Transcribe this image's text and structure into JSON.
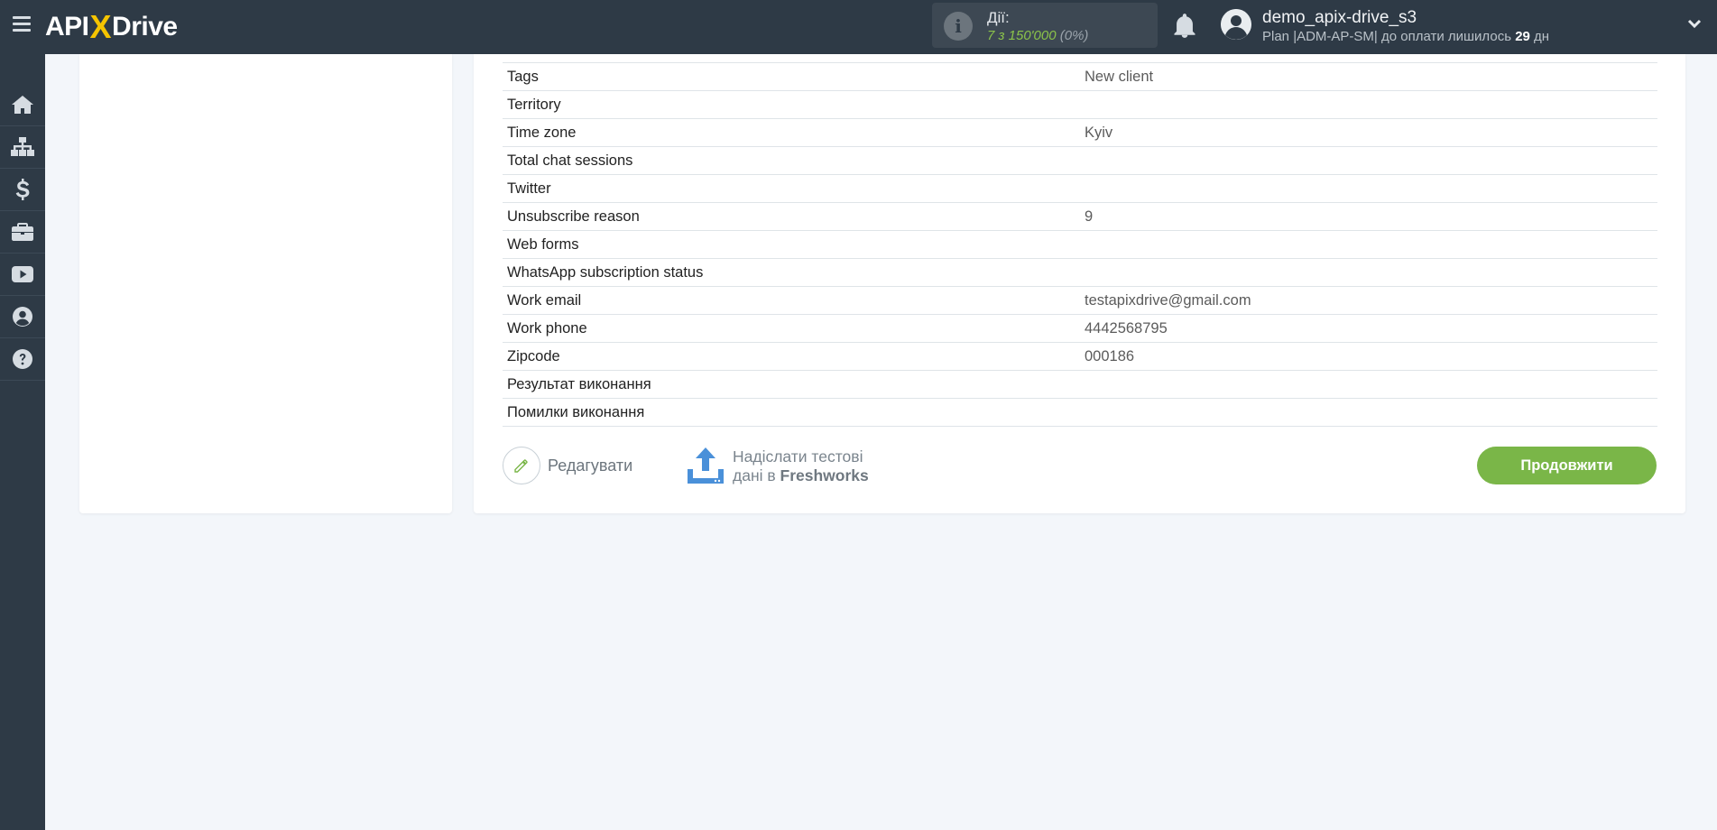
{
  "header": {
    "logo": {
      "left": "API",
      "x": "X",
      "right": "Drive"
    },
    "actions": {
      "label": "Дії:",
      "used": "7",
      "of": " з 150'000",
      "percent": " (0%)"
    },
    "user": {
      "name": "demo_apix-drive_s3",
      "plan_prefix": "Plan |ADM-AP-SM| до оплати лишилось ",
      "days": "29",
      "days_suffix": " дн"
    }
  },
  "sidebar": {
    "items": [
      "home-icon",
      "sitemap-icon",
      "dollar-icon",
      "briefcase-icon",
      "video-icon",
      "user-icon",
      "help-icon"
    ]
  },
  "table": {
    "rows": [
      {
        "field": "Tags",
        "value": "New client"
      },
      {
        "field": "Territory",
        "value": ""
      },
      {
        "field": "Time zone",
        "value": "Kyiv"
      },
      {
        "field": "Total chat sessions",
        "value": ""
      },
      {
        "field": "Twitter",
        "value": ""
      },
      {
        "field": "Unsubscribe reason",
        "value": "9"
      },
      {
        "field": "Web forms",
        "value": ""
      },
      {
        "field": "WhatsApp subscription status",
        "value": ""
      },
      {
        "field": "Work email",
        "value": "testapixdrive@gmail.com"
      },
      {
        "field": "Work phone",
        "value": "4442568795"
      },
      {
        "field": "Zipcode",
        "value": "000186"
      },
      {
        "field": "Результат виконання",
        "value": ""
      },
      {
        "field": "Помилки виконання",
        "value": ""
      }
    ]
  },
  "buttons": {
    "edit": "Редагувати",
    "send_line1": "Надіслати тестові",
    "send_line2_prefix": "дані в ",
    "send_target": "Freshworks",
    "continue": "Продовжити"
  },
  "colors": {
    "topbar": "#2e3a46",
    "accent_green": "#7ab648",
    "used_green": "#8bc34a",
    "logo_x": "#f5c400",
    "upload_blue": "#4a90d9"
  }
}
